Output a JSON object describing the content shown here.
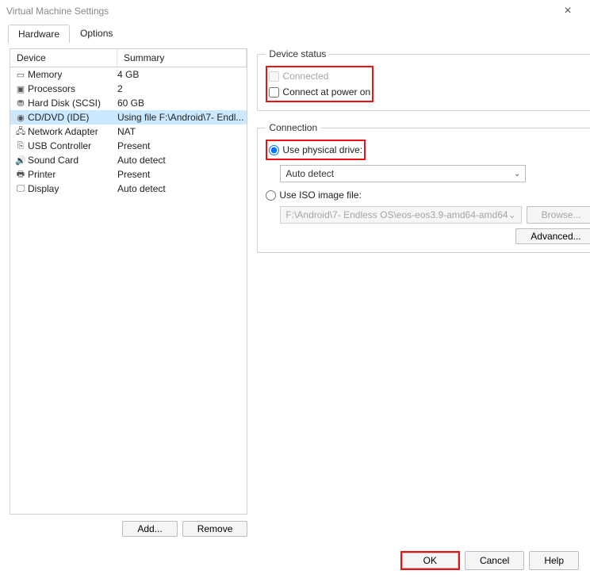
{
  "window": {
    "title": "Virtual Machine Settings"
  },
  "tabs": {
    "hardware": "Hardware",
    "options": "Options",
    "active": "hardware"
  },
  "device_table": {
    "col_device": "Device",
    "col_summary": "Summary",
    "rows": [
      {
        "icon": "memory-icon",
        "glyph": "▭",
        "name": "Memory",
        "summary": "4 GB",
        "selected": false
      },
      {
        "icon": "cpu-icon",
        "glyph": "▣",
        "name": "Processors",
        "summary": "2",
        "selected": false
      },
      {
        "icon": "hdd-icon",
        "glyph": "⛃",
        "name": "Hard Disk (SCSI)",
        "summary": "60 GB",
        "selected": false
      },
      {
        "icon": "cd-icon",
        "glyph": "◉",
        "name": "CD/DVD (IDE)",
        "summary": "Using file F:\\Android\\7- Endl...",
        "selected": true
      },
      {
        "icon": "network-icon",
        "glyph": "🖧",
        "name": "Network Adapter",
        "summary": "NAT",
        "selected": false
      },
      {
        "icon": "usb-icon",
        "glyph": "⎘",
        "name": "USB Controller",
        "summary": "Present",
        "selected": false
      },
      {
        "icon": "sound-icon",
        "glyph": "🔊",
        "name": "Sound Card",
        "summary": "Auto detect",
        "selected": false
      },
      {
        "icon": "printer-icon",
        "glyph": "🖶",
        "name": "Printer",
        "summary": "Present",
        "selected": false
      },
      {
        "icon": "display-icon",
        "glyph": "🖵",
        "name": "Display",
        "summary": "Auto detect",
        "selected": false
      }
    ]
  },
  "left_buttons": {
    "add": "Add...",
    "remove": "Remove"
  },
  "device_status": {
    "legend": "Device status",
    "connected_label": "Connected",
    "connected_checked": false,
    "connected_disabled": true,
    "power_on_label": "Connect at power on",
    "power_on_checked": false
  },
  "connection": {
    "legend": "Connection",
    "physical_label": "Use physical drive:",
    "physical_selected": true,
    "physical_drive_value": "Auto detect",
    "iso_label": "Use ISO image file:",
    "iso_selected": false,
    "iso_path": "F:\\Android\\7- Endless OS\\eos-eos3.9-amd64-amd64",
    "browse_label": "Browse...",
    "advanced_label": "Advanced..."
  },
  "bottom": {
    "ok": "OK",
    "cancel": "Cancel",
    "help": "Help"
  }
}
